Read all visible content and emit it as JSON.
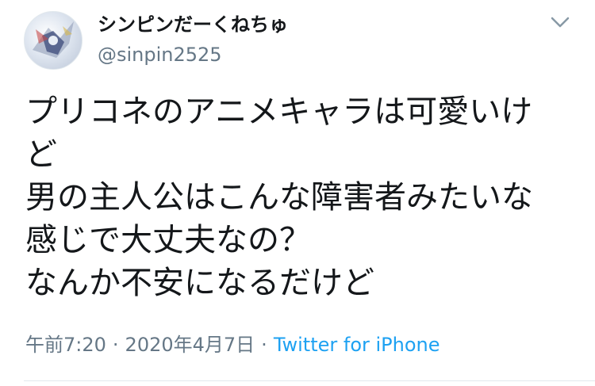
{
  "tweet": {
    "display_name": "シンピンだーくねちゅ",
    "handle": "@sinpin2525",
    "avatar_icon": "avatar-image",
    "menu_icon": "chevron-down-icon",
    "lines": [
      "プリコネのアニメキャラは可愛いけ",
      "ど",
      "男の主人公はこんな障害者みたいな",
      "感じで大丈夫なの？",
      "なんか不安になるだけど"
    ],
    "time": "午前7:20",
    "date": "2020年4月7日",
    "separator": "·",
    "source": "Twitter for iPhone",
    "colors": {
      "source_link": "#1da1f2",
      "secondary_text": "#657786"
    }
  }
}
